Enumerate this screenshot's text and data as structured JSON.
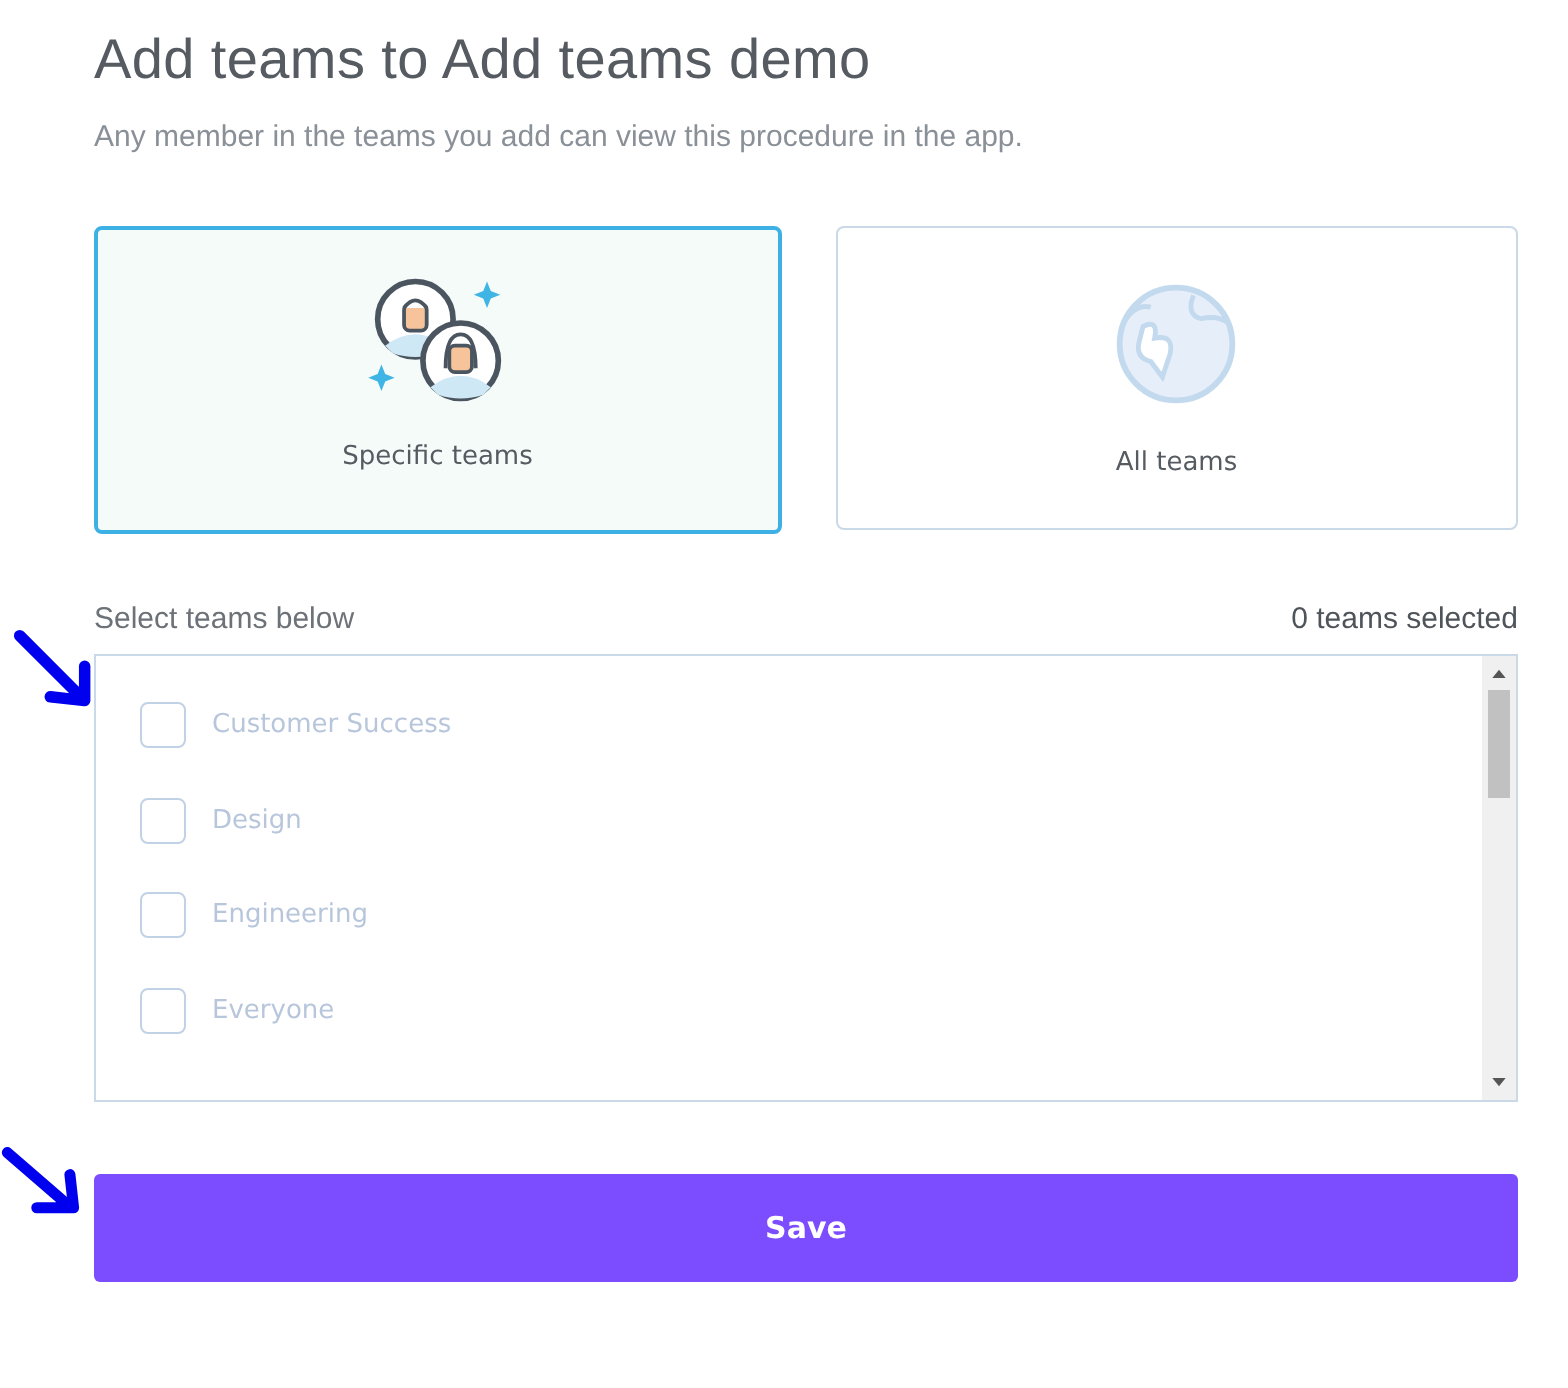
{
  "title": "Add teams to Add teams demo",
  "subtitle": "Any member in the teams you add can view this procedure in the app.",
  "options": [
    {
      "kind": "specific",
      "label": "Specific teams",
      "selected": true
    },
    {
      "kind": "all",
      "label": "All teams",
      "selected": false
    }
  ],
  "list_label": "Select teams below",
  "selected_count": "0 teams selected",
  "teams": [
    {
      "name": "Customer Success",
      "checked": false
    },
    {
      "name": "Design",
      "checked": false
    },
    {
      "name": "Engineering",
      "checked": false
    },
    {
      "name": "Everyone",
      "checked": false
    }
  ],
  "save_button": "Save"
}
